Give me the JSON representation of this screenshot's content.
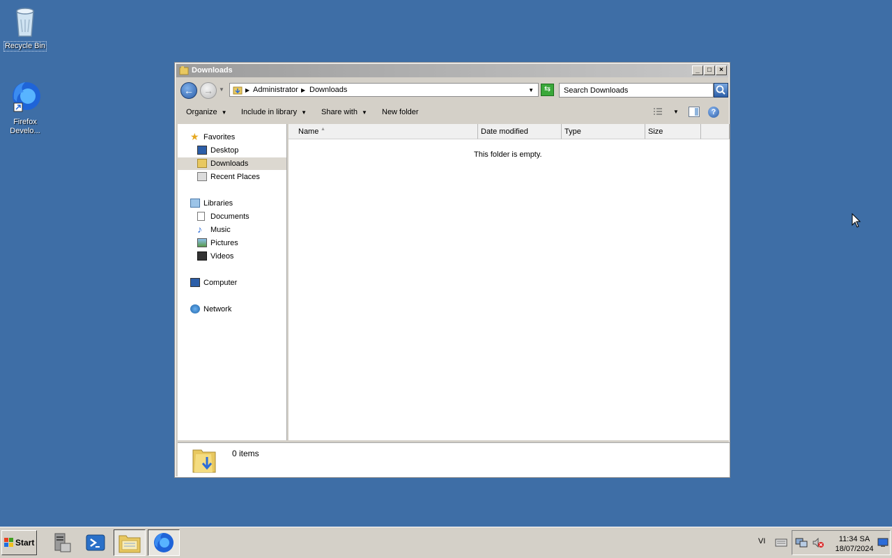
{
  "desktop": {
    "recycle_bin_label": "Recycle Bin",
    "firefox_label_line1": "Firefox",
    "firefox_label_line2": "Develo..."
  },
  "window": {
    "title": "Downloads",
    "breadcrumb": [
      "Administrator",
      "Downloads"
    ],
    "search_placeholder": "Search Downloads",
    "toolbar": {
      "organize": "Organize",
      "include_in_library": "Include in library",
      "share_with": "Share with",
      "new_folder": "New folder"
    },
    "nav": {
      "favorites": "Favorites",
      "desktop": "Desktop",
      "downloads": "Downloads",
      "recent_places": "Recent Places",
      "libraries": "Libraries",
      "documents": "Documents",
      "music": "Music",
      "pictures": "Pictures",
      "videos": "Videos",
      "computer": "Computer",
      "network": "Network"
    },
    "columns": [
      "Name",
      "Date modified",
      "Type",
      "Size"
    ],
    "empty_message": "This folder is empty.",
    "details_count": "0 items"
  },
  "taskbar": {
    "start_label": "Start",
    "language": "VI",
    "time": "11:34 SA",
    "date": "18/07/2024"
  },
  "colors": {
    "desktop": "#3e6ea6",
    "selection": "#dcd8d0"
  }
}
